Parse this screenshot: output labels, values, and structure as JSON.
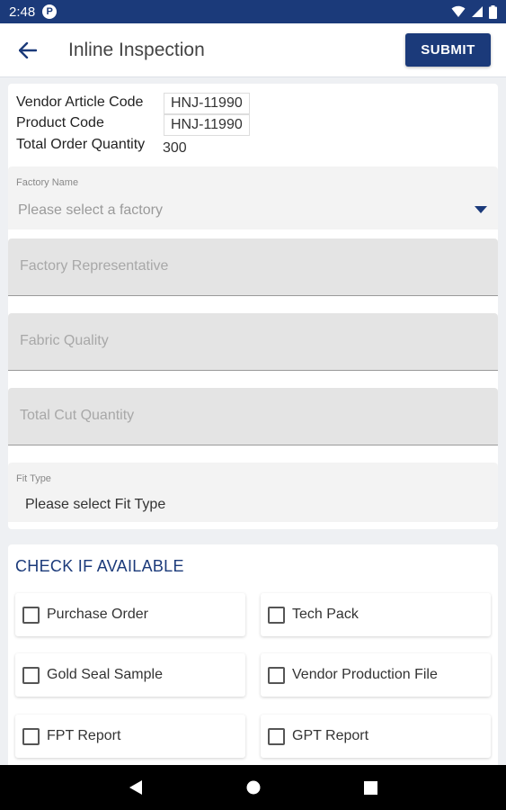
{
  "status_bar": {
    "time": "2:48",
    "notification_letter": "P"
  },
  "app_bar": {
    "title": "Inline Inspection",
    "submit_label": "SUBMIT"
  },
  "order_info": {
    "vendor_article_code_label": "Vendor Article Code",
    "vendor_article_code_value": "HNJ-11990",
    "product_code_label": "Product Code",
    "product_code_value": "HNJ-11990",
    "total_order_quantity_label": "Total Order Quantity",
    "total_order_quantity_value": "300"
  },
  "form": {
    "factory_name_label": "Factory Name",
    "factory_name_placeholder": "Please select a factory",
    "factory_representative_placeholder": "Factory Representative",
    "fabric_quality_placeholder": "Fabric Quality",
    "total_cut_quantity_placeholder": "Total Cut Quantity",
    "fit_type_label": "Fit Type",
    "fit_type_value": "Please select Fit Type"
  },
  "checklist": {
    "title": "CHECK IF AVAILABLE",
    "items": [
      {
        "label": "Purchase Order",
        "checked": false
      },
      {
        "label": "Tech Pack",
        "checked": false
      },
      {
        "label": "Gold Seal Sample",
        "checked": false
      },
      {
        "label": "Vendor Production File",
        "checked": false
      },
      {
        "label": "FPT Report",
        "checked": false
      },
      {
        "label": "GPT Report",
        "checked": false
      }
    ]
  },
  "colors": {
    "primary": "#1b3a7a",
    "background": "#eef0f3",
    "field_fill": "#e4e4e4"
  },
  "icons": {
    "back": "arrow-left-icon",
    "wifi": "wifi-icon",
    "signal": "signal-icon",
    "battery": "battery-icon",
    "nav_back": "triangle-back-icon",
    "nav_home": "circle-home-icon",
    "nav_recents": "square-recents-icon"
  }
}
